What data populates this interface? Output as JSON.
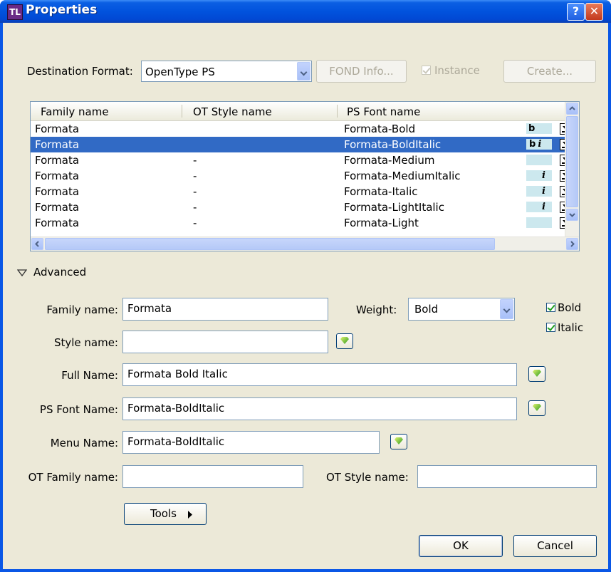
{
  "window": {
    "title": "Properties",
    "app_icon": "app-logo-icon"
  },
  "top": {
    "dest_format_label": "Destination Format:",
    "dest_format_value": "OpenType PS",
    "fond_info_label": "FOND Info...",
    "instance_label": "Instance",
    "instance_checked": true,
    "create_label": "Create..."
  },
  "table": {
    "headers": [
      "Family name",
      "OT Style name",
      "PS Font name"
    ],
    "rows": [
      {
        "family": "Formata",
        "ot_style": "",
        "ps_name": "Formata-Bold",
        "style_tag": "b"
      },
      {
        "family": "Formata",
        "ot_style": "",
        "ps_name": "Formata-BoldItalic",
        "style_tag": "bi",
        "selected": true
      },
      {
        "family": "Formata",
        "ot_style": "-",
        "ps_name": "Formata-Medium",
        "style_tag": ""
      },
      {
        "family": "Formata",
        "ot_style": "-",
        "ps_name": "Formata-MediumItalic",
        "style_tag": "i"
      },
      {
        "family": "Formata",
        "ot_style": "-",
        "ps_name": "Formata-Italic",
        "style_tag": "i"
      },
      {
        "family": "Formata",
        "ot_style": "-",
        "ps_name": "Formata-LightItalic",
        "style_tag": "i"
      },
      {
        "family": "Formata",
        "ot_style": "-",
        "ps_name": "Formata-Light",
        "style_tag": ""
      }
    ]
  },
  "advanced": {
    "toggle_label": "Advanced",
    "family_name_label": "Family name:",
    "family_name_value": "Formata",
    "weight_label": "Weight:",
    "weight_value": "Bold",
    "bold_label": "Bold",
    "bold_checked": true,
    "italic_label": "Italic",
    "italic_checked": true,
    "style_name_label": "Style name:",
    "style_name_value": "",
    "full_name_label": "Full Name:",
    "full_name_value": "Formata Bold Italic",
    "ps_font_name_label": "PS Font Name:",
    "ps_font_name_value": "Formata-BoldItalic",
    "menu_name_label": "Menu Name:",
    "menu_name_value": "Formata-BoldItalic",
    "ot_family_label": "OT Family name:",
    "ot_family_value": "",
    "ot_style_label": "OT Style name:",
    "ot_style_value": "",
    "tools_label": "Tools"
  },
  "footer": {
    "ok_label": "OK",
    "cancel_label": "Cancel"
  }
}
